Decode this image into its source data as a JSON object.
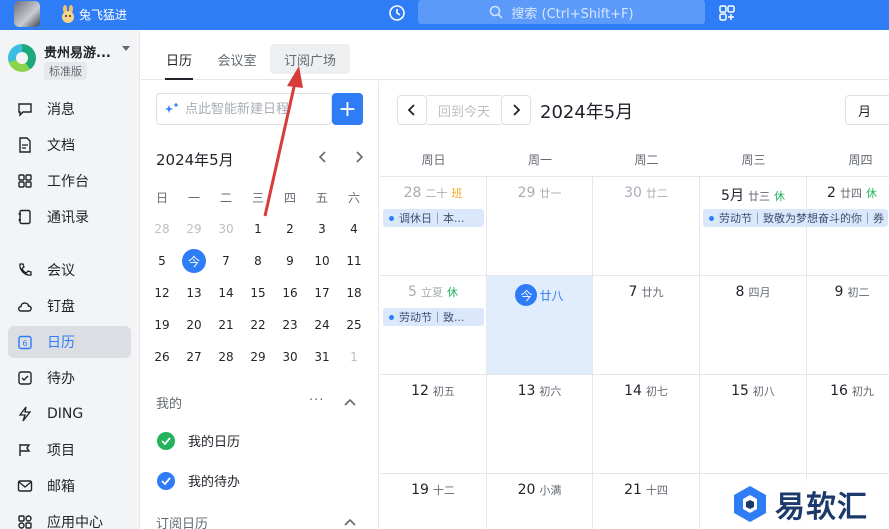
{
  "topbar": {
    "status_text": "兔飞猛进",
    "search_placeholder": "搜索 (Ctrl+Shift+F)"
  },
  "org": {
    "name": "贵州易游...",
    "badge": "标准版"
  },
  "nav": {
    "items": [
      {
        "label": "消息",
        "icon": "message-icon"
      },
      {
        "label": "文档",
        "icon": "document-icon"
      },
      {
        "label": "工作台",
        "icon": "workbench-icon"
      },
      {
        "label": "通讯录",
        "icon": "contacts-icon"
      },
      {
        "label": "会议",
        "icon": "meeting-icon"
      },
      {
        "label": "钉盘",
        "icon": "cloud-drive-icon"
      },
      {
        "label": "日历",
        "icon": "calendar-icon"
      },
      {
        "label": "待办",
        "icon": "todo-icon"
      },
      {
        "label": "DING",
        "icon": "ding-icon"
      },
      {
        "label": "项目",
        "icon": "project-icon"
      },
      {
        "label": "邮箱",
        "icon": "mail-icon"
      },
      {
        "label": "应用中心",
        "icon": "app-center-icon"
      }
    ],
    "active_index": 6
  },
  "tabs": {
    "calendar": "日历",
    "meeting_room": "会议室",
    "subscribe": "订阅广场"
  },
  "quick_add": {
    "placeholder": "点此智能新建日程",
    "plus": "+"
  },
  "mini_calendar": {
    "title": "2024年5月",
    "weekday_headers": [
      "日",
      "一",
      "二",
      "三",
      "四",
      "五",
      "六"
    ],
    "weeks": [
      [
        "28",
        "29",
        "30",
        "1",
        "2",
        "3",
        "4"
      ],
      [
        "5",
        "今",
        "7",
        "8",
        "9",
        "10",
        "11"
      ],
      [
        "12",
        "13",
        "14",
        "15",
        "16",
        "17",
        "18"
      ],
      [
        "19",
        "20",
        "21",
        "22",
        "23",
        "24",
        "25"
      ],
      [
        "26",
        "27",
        "28",
        "29",
        "30",
        "31",
        "1"
      ]
    ]
  },
  "my_section": {
    "title": "我的",
    "more": "···",
    "items": [
      "我的日历",
      "我的待办"
    ]
  },
  "subscribed_section": {
    "title": "订阅日历"
  },
  "main": {
    "today_button": "回到今天",
    "month_title": "2024年5月",
    "view_select": "月",
    "weekdays": [
      "周日",
      "周一",
      "周二",
      "周三",
      "周四"
    ],
    "weeks": [
      [
        {
          "n": "28",
          "lunar": "二十",
          "tag": "班",
          "tag_color": "#f5a623",
          "dim": true,
          "event": "调休日｜本..."
        },
        {
          "n": "29",
          "lunar": "廿一",
          "dim": true
        },
        {
          "n": "30",
          "lunar": "廿二",
          "dim": true
        },
        {
          "n": "5月",
          "lunar": "廿三",
          "tag": "休",
          "tag_color": "#24b35c",
          "event": "劳动节｜致敬为梦想奋斗的你｜券"
        },
        {
          "n": "2",
          "lunar": "廿四",
          "tag": "休",
          "tag_color": "#24b35c"
        }
      ],
      [
        {
          "n": "5",
          "lunar": "立夏",
          "tag": "休",
          "tag_color": "#24b35c",
          "dim": true,
          "event": "劳动节｜致..."
        },
        {
          "n": "今",
          "lunar": "廿八",
          "today": true
        },
        {
          "n": "7",
          "lunar": "廿九"
        },
        {
          "n": "8",
          "lunar": "四月"
        },
        {
          "n": "9",
          "lunar": "初二"
        }
      ],
      [
        {
          "n": "12",
          "lunar": "初五"
        },
        {
          "n": "13",
          "lunar": "初六"
        },
        {
          "n": "14",
          "lunar": "初七"
        },
        {
          "n": "15",
          "lunar": "初八"
        },
        {
          "n": "16",
          "lunar": "初九"
        }
      ],
      [
        {
          "n": "19",
          "lunar": "十二"
        },
        {
          "n": "20",
          "lunar": "小满"
        },
        {
          "n": "21",
          "lunar": "十四"
        },
        {
          "n": "",
          "lunar": ""
        },
        {
          "n": "",
          "lunar": ""
        }
      ]
    ]
  },
  "watermark": {
    "text": "易软汇"
  },
  "colors": {
    "accent": "#2e7cf6",
    "annotation_arrow": "#d93a3a",
    "rest_day": "#24b35c",
    "work_day": "#f5a623"
  }
}
